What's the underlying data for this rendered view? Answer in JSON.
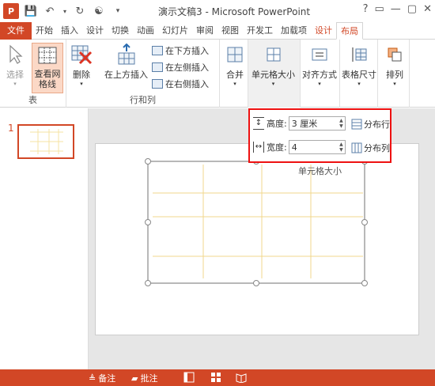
{
  "window": {
    "title": "演示文稿3 - Microsoft PowerPoint",
    "logo": "P",
    "controls": [
      "?",
      "▭",
      "—",
      "▢",
      "✕"
    ]
  },
  "tabs": [
    "文件",
    "开始",
    "插入",
    "设计",
    "切换",
    "动画",
    "幻灯片",
    "审阅",
    "视图",
    "开发工",
    "加载项",
    "设计",
    "布局"
  ],
  "ribbon": {
    "select_label": "选择",
    "gridlines_label": "查看网格线",
    "delete_label": "删除",
    "insert_above_label": "在上方插入",
    "insert_below_label": "在下方插入",
    "insert_left_label": "在左侧插入",
    "insert_right_label": "在右侧插入",
    "merge_label": "合并",
    "cell_size_label": "单元格大小",
    "align_label": "对齐方式",
    "table_size_label": "表格尺寸",
    "arrange_label": "排列",
    "group_table": "表",
    "group_rows_cols": "行和列"
  },
  "cell_size_panel": {
    "height_label": "高度:",
    "height_value": "3 厘米",
    "width_label": "宽度:",
    "width_value": "4",
    "distribute_rows": "分布行",
    "distribute_cols": "分布列",
    "group_label": "单元格大小"
  },
  "slides": {
    "number": "1"
  },
  "statusbar": {
    "notes": "备注",
    "comments": "批注"
  }
}
